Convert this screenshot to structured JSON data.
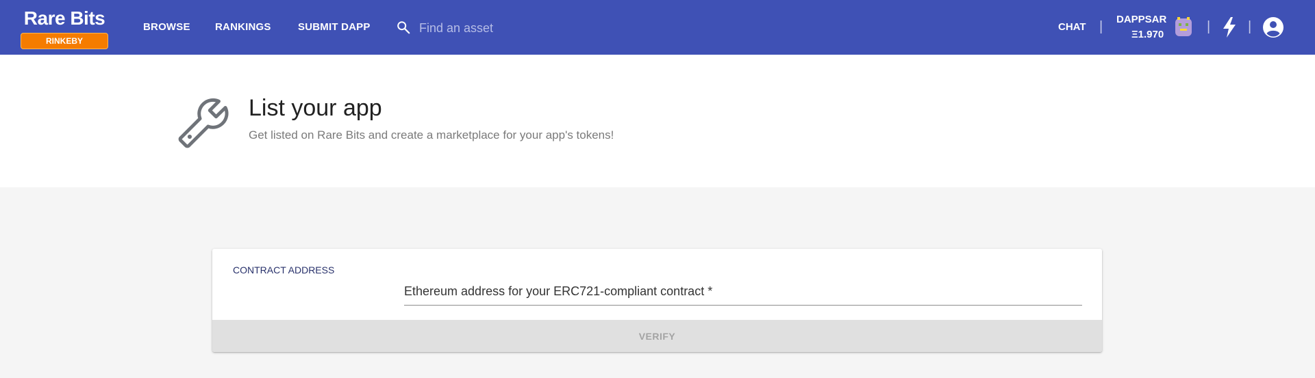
{
  "header": {
    "logo": "Rare Bits",
    "network_badge": "RINKEBY",
    "nav": [
      "BROWSE",
      "RANKINGS",
      "SUBMIT DAPP"
    ],
    "search_placeholder": "Find an asset",
    "chat": "CHAT",
    "separator": "|",
    "username": "DAPPSAR",
    "balance": "Ξ1.970",
    "icons": [
      "search-icon",
      "avatar",
      "lightning-icon",
      "account-icon"
    ],
    "colors": {
      "bar": "#3f51b5",
      "badge": "#f57c00"
    }
  },
  "hero": {
    "title": "List your app",
    "subtitle": "Get listed on Rare Bits and create a marketplace for your app's tokens!",
    "icon": "wrench-icon"
  },
  "form": {
    "label": "CONTRACT ADDRESS",
    "placeholder": "Ethereum address for your ERC721-compliant contract *",
    "verify_label": "VERIFY"
  }
}
